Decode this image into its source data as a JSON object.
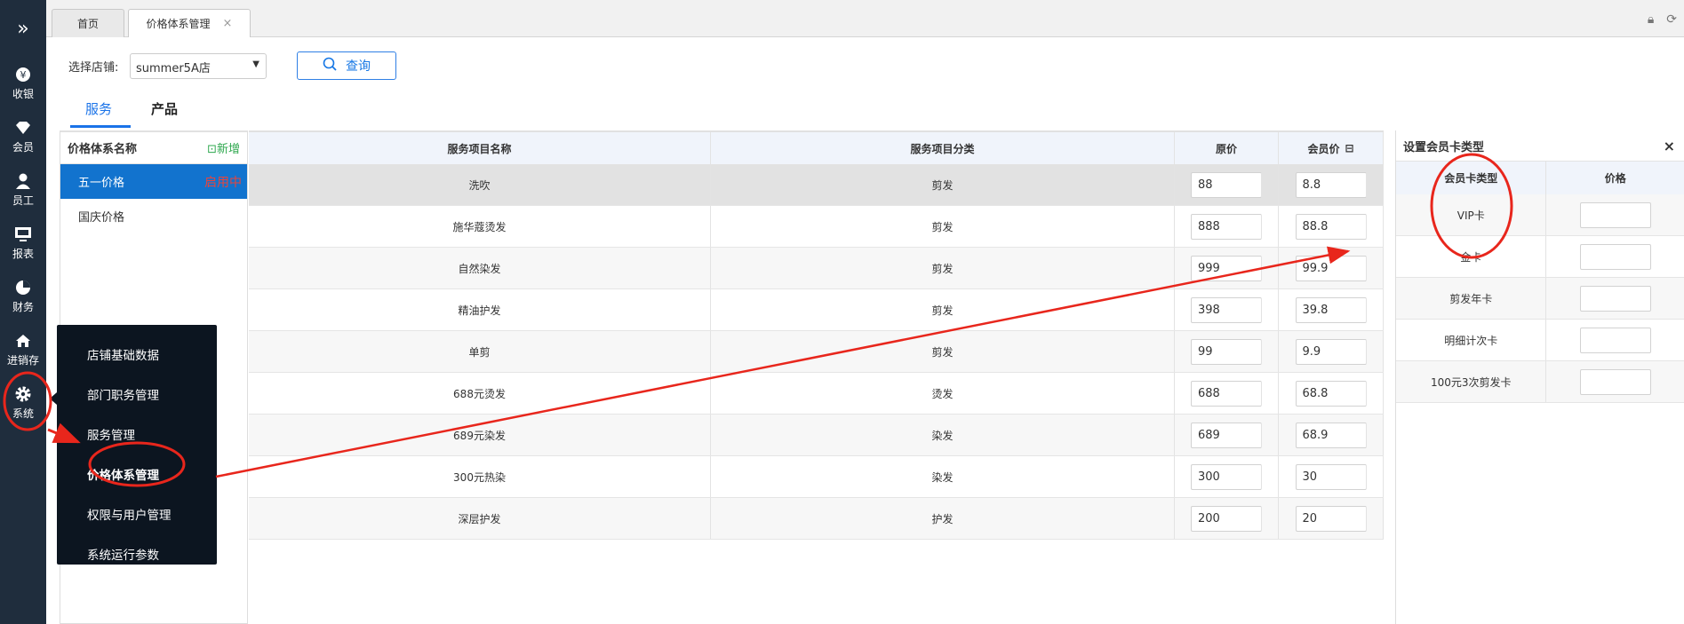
{
  "nav": {
    "expand_icon": "chevron-double-right-icon",
    "items": [
      {
        "label": "收银",
        "icon": "yen-icon"
      },
      {
        "label": "会员",
        "icon": "diamond-icon"
      },
      {
        "label": "员工",
        "icon": "person-icon"
      },
      {
        "label": "报表",
        "icon": "monitor-icon"
      },
      {
        "label": "财务",
        "icon": "pie-chart-icon"
      },
      {
        "label": "进销存",
        "icon": "house-icon"
      },
      {
        "label": "系统",
        "icon": "gear-icon"
      }
    ]
  },
  "tabs": [
    {
      "label": "首页"
    },
    {
      "label": "价格体系管理",
      "close": "×"
    }
  ],
  "toolbar": {
    "store_label": "选择店铺:",
    "store_value": "summer5A店",
    "query_label": "查询"
  },
  "product_tabs": {
    "service": "服务",
    "product": "产品"
  },
  "price_list": {
    "header": "价格体系名称",
    "add_label": "新增",
    "items": [
      {
        "name": "五一价格",
        "status": "启用中"
      },
      {
        "name": "国庆价格",
        "status": ""
      }
    ]
  },
  "table": {
    "headers": [
      "服务项目名称",
      "服务项目分类",
      "原价",
      "会员价"
    ],
    "rows": [
      {
        "name": "洗吹",
        "category": "剪发",
        "price": "88",
        "member_price": "8.8"
      },
      {
        "name": "施华蔻烫发",
        "category": "剪发",
        "price": "888",
        "member_price": "88.8"
      },
      {
        "name": "自然染发",
        "category": "剪发",
        "price": "999",
        "member_price": "99.9"
      },
      {
        "name": "精油护发",
        "category": "剪发",
        "price": "398",
        "member_price": "39.8"
      },
      {
        "name": "单剪",
        "category": "剪发",
        "price": "99",
        "member_price": "9.9"
      },
      {
        "name": "688元烫发",
        "category": "烫发",
        "price": "688",
        "member_price": "68.8"
      },
      {
        "name": "689元染发",
        "category": "染发",
        "price": "689",
        "member_price": "68.9"
      },
      {
        "name": "300元热染",
        "category": "染发",
        "price": "300",
        "member_price": "30"
      },
      {
        "name": "深层护发",
        "category": "护发",
        "price": "200",
        "member_price": "20"
      }
    ]
  },
  "card_panel": {
    "title": "设置会员卡类型",
    "close": "×",
    "headers": [
      "会员卡类型",
      "价格"
    ],
    "rows": [
      {
        "type": "VIP卡",
        "price": ""
      },
      {
        "type": "金卡",
        "price": ""
      },
      {
        "type": "剪发年卡",
        "price": ""
      },
      {
        "type": "明细计次卡",
        "price": ""
      },
      {
        "type": "100元3次剪发卡",
        "price": ""
      }
    ]
  },
  "system_menu": {
    "items": [
      {
        "label": "店铺基础数据"
      },
      {
        "label": "部门职务管理"
      },
      {
        "label": "服务管理"
      },
      {
        "label": "价格体系管理"
      },
      {
        "label": "权限与用户管理"
      },
      {
        "label": "系统运行参数"
      }
    ]
  },
  "colors": {
    "accent": "#1a73e8",
    "nav_bg": "#1f2d3d",
    "annotation": "#e8261c",
    "active_status": "#e8453c"
  }
}
